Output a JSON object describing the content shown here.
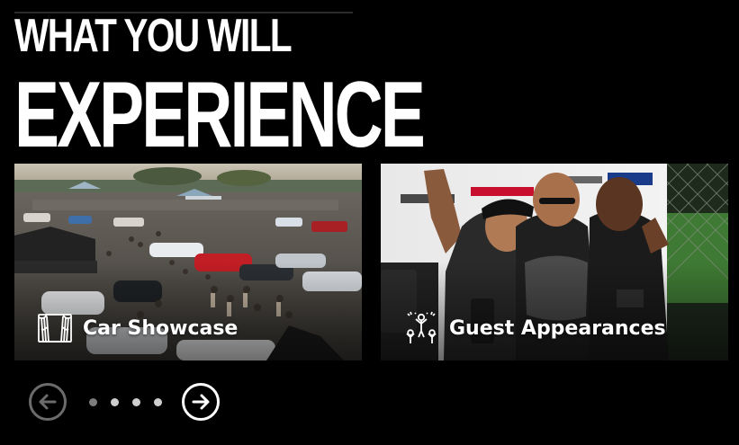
{
  "section": {
    "heading_line1": "WHAT YOU WILL",
    "heading_line2": "EXPERIENCE"
  },
  "cards": [
    {
      "title": "Car Showcase",
      "icon": "stage-curtain-icon"
    },
    {
      "title": "Guest Appearances",
      "icon": "celebration-crowd-icon"
    }
  ],
  "carousel": {
    "prev_icon": "arrow-left-circle-icon",
    "next_icon": "arrow-right-circle-icon",
    "dot_count": 4,
    "active_dot": 1
  },
  "colors": {
    "background": "#000000",
    "text": "#ffffff",
    "prev_button": "#6b6b6b",
    "next_button": "#ffffff",
    "dot": "#cfcfcf",
    "dot_active": "#7d7d7d"
  }
}
